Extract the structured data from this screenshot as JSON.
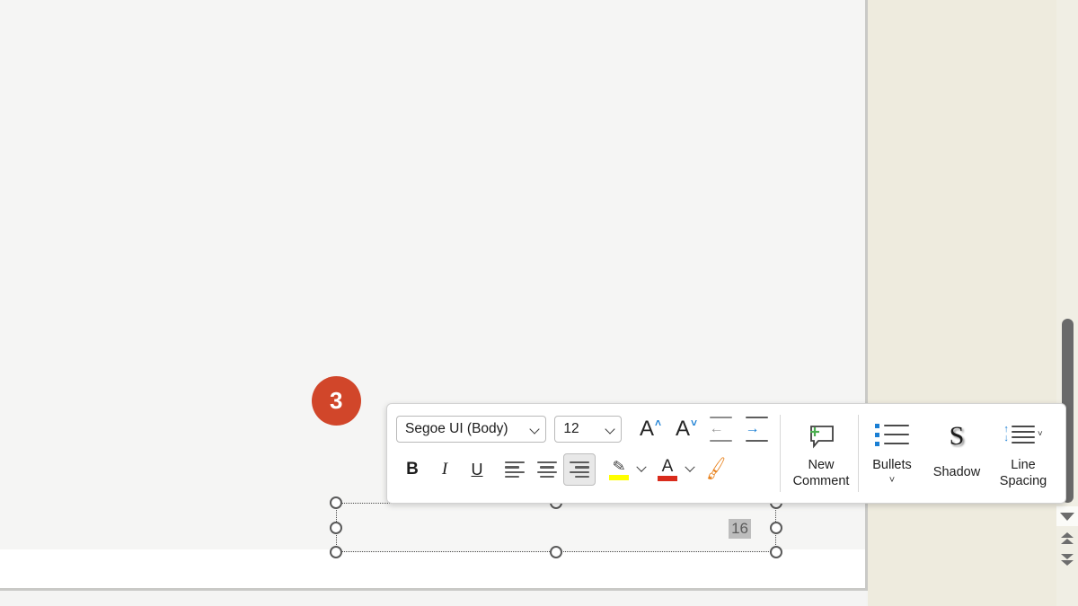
{
  "app": {
    "surface": "powerpoint-slide-editor",
    "slide_background": "#f5f5f4",
    "pane_background": "#edeadc",
    "accent": "#1a7fd4"
  },
  "step_badge": {
    "number": "3",
    "color": "#d1462a",
    "text_color": "#ffffff"
  },
  "textbox": {
    "selected_text": "16",
    "selection_highlight": "#bdbdbd",
    "handles": 8
  },
  "mini_toolbar": {
    "font_name": {
      "value": "Segoe UI (Body)",
      "placeholder": "Font"
    },
    "font_size": {
      "value": "12",
      "placeholder": "Size"
    },
    "buttons_row1": [
      {
        "name": "increase-font-size",
        "label": "A",
        "caret": "˄"
      },
      {
        "name": "decrease-font-size",
        "label": "A",
        "caret": "˅"
      },
      {
        "name": "decrease-indent",
        "label": "Decrease Indent",
        "state": "disabled"
      },
      {
        "name": "increase-indent",
        "label": "Increase Indent",
        "state": "enabled"
      }
    ],
    "buttons_row2": [
      {
        "name": "bold",
        "label": "B",
        "state": "off"
      },
      {
        "name": "italic",
        "label": "I",
        "state": "off"
      },
      {
        "name": "underline",
        "label": "U",
        "state": "off"
      },
      {
        "name": "align-left",
        "label": "Align Left",
        "state": "off"
      },
      {
        "name": "align-center",
        "label": "Center",
        "state": "off"
      },
      {
        "name": "align-right",
        "label": "Align Right",
        "state": "on"
      },
      {
        "name": "text-highlight-color",
        "label": "Text Highlight Color",
        "color": "#ffff00"
      },
      {
        "name": "font-color",
        "label": "Font Color",
        "color": "#d92b1c"
      },
      {
        "name": "format-painter",
        "label": "Format Painter",
        "color": "#e8821e"
      }
    ],
    "new_comment": {
      "label": "New\nComment",
      "icon": "new-comment-icon",
      "plus_color": "#4caf50"
    },
    "bullets": {
      "label": "Bullets",
      "icon": "bullets-icon",
      "has_dropdown": true
    },
    "shadow": {
      "label": "Shadow",
      "icon": "shadow-S-icon",
      "glyph": "S"
    },
    "line_spacing": {
      "label": "Line\nSpacing",
      "icon": "line-spacing-icon",
      "has_dropdown": true
    }
  },
  "scrollbar": {
    "thumb_color": "#6a6a6a",
    "down_arrow": "▼",
    "previous_slide": "previous-slide-icon",
    "next_slide": "next-slide-icon"
  }
}
